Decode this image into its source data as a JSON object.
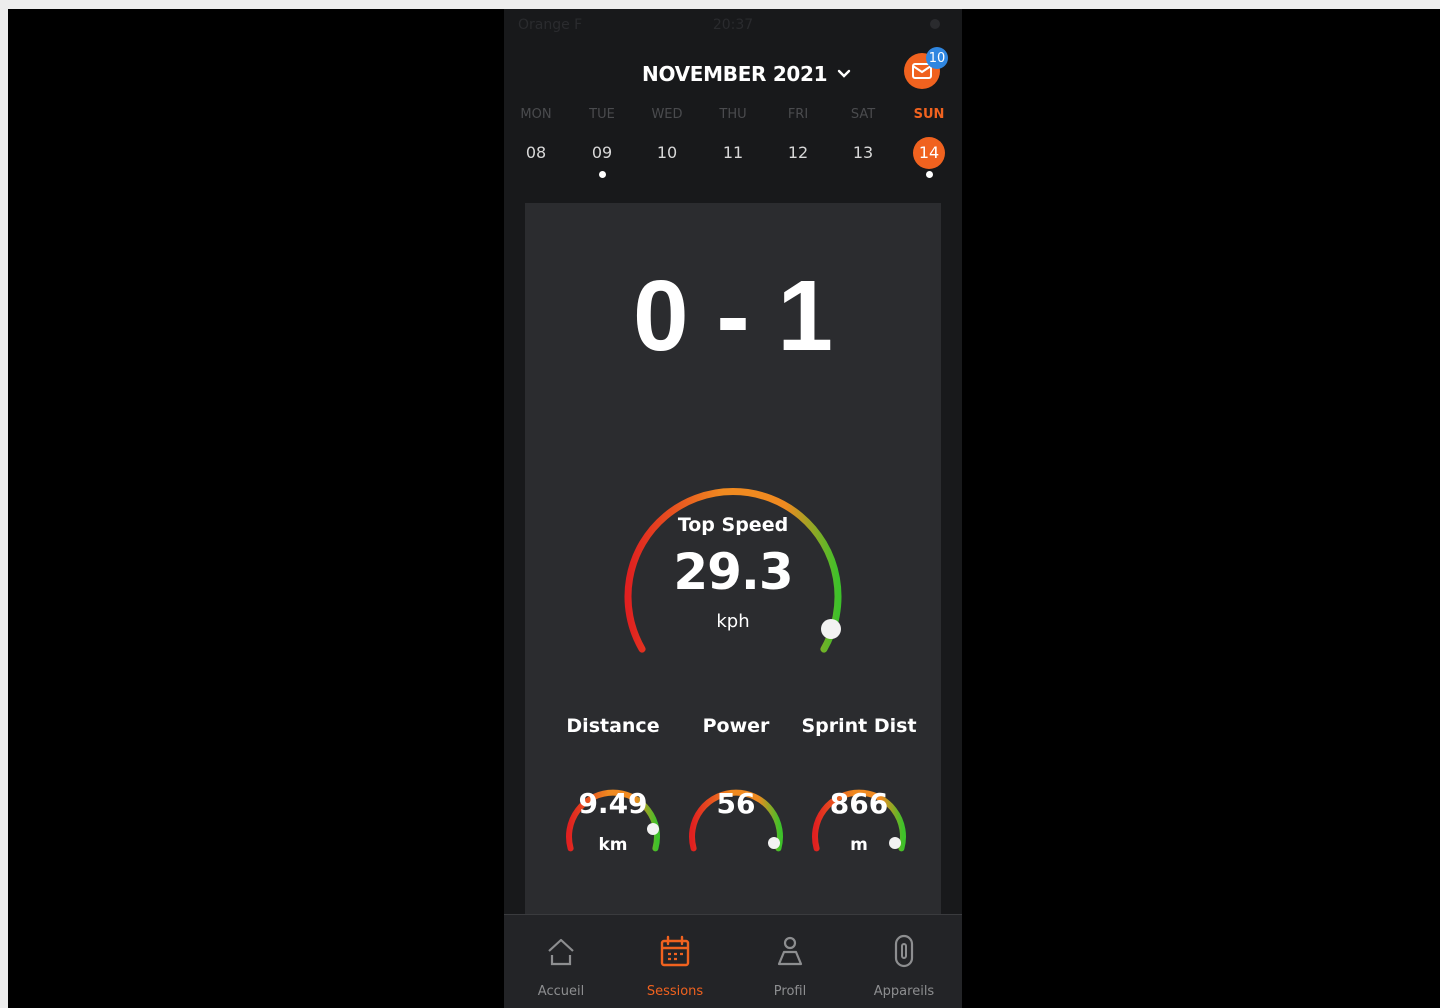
{
  "status_bar": {
    "carrier": "Orange F",
    "time": "20:37"
  },
  "header": {
    "month": "NOVEMBER 2021",
    "notifications_count": "10"
  },
  "week": [
    {
      "name": "MON",
      "num": "08",
      "has_session": false,
      "active": false
    },
    {
      "name": "TUE",
      "num": "09",
      "has_session": true,
      "active": false
    },
    {
      "name": "WED",
      "num": "10",
      "has_session": false,
      "active": false
    },
    {
      "name": "THU",
      "num": "11",
      "has_session": false,
      "active": false
    },
    {
      "name": "FRI",
      "num": "12",
      "has_session": false,
      "active": false
    },
    {
      "name": "SAT",
      "num": "13",
      "has_session": false,
      "active": false
    },
    {
      "name": "SUN",
      "num": "14",
      "has_session": true,
      "active": true
    }
  ],
  "session": {
    "score": "0 - 1",
    "top_speed": {
      "label": "Top Speed",
      "value": "29.3",
      "unit": "kph"
    },
    "metrics": [
      {
        "label": "Distance",
        "value": "9.49",
        "unit": "km"
      },
      {
        "label": "Power",
        "value": "56",
        "unit": ""
      },
      {
        "label": "Sprint Dist",
        "value": "866",
        "unit": "m"
      }
    ]
  },
  "tabbar": {
    "items": [
      {
        "label": "Accueil",
        "icon": "home-icon",
        "active": false
      },
      {
        "label": "Sessions",
        "icon": "calendar-icon",
        "active": true
      },
      {
        "label": "Profil",
        "icon": "profile-icon",
        "active": false
      },
      {
        "label": "Appareils",
        "icon": "device-icon",
        "active": false
      }
    ]
  },
  "colors": {
    "accent": "#f0621f",
    "badge": "#2f86e0",
    "gauge_red": "#e02020",
    "gauge_orange": "#f08a20",
    "gauge_green": "#3ec12a"
  }
}
